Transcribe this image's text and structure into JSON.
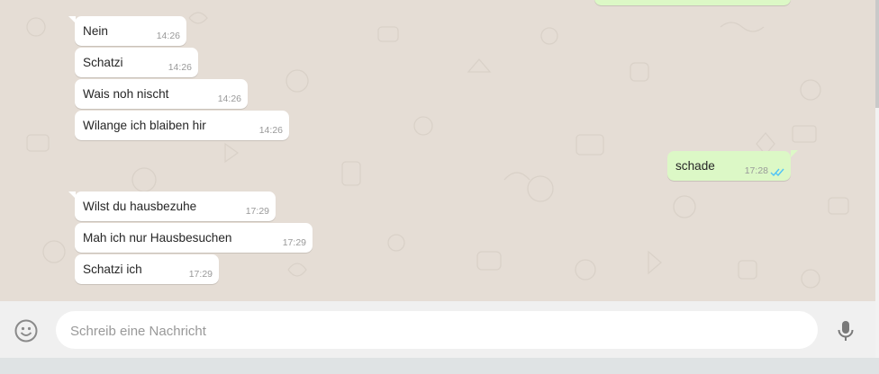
{
  "messages": [
    {
      "dir": "in",
      "text": "Nein",
      "time": "14:26"
    },
    {
      "dir": "in",
      "text": "Schatzi",
      "time": "14:26"
    },
    {
      "dir": "in",
      "text": "Wais noh nischt",
      "time": "14:26"
    },
    {
      "dir": "in",
      "text": "Wilange ich blaiben hir",
      "time": "14:26"
    },
    {
      "dir": "out",
      "text": "schade",
      "time": "17:28",
      "status": "read-double-check-icon"
    },
    {
      "dir": "in",
      "text": "Wilst du hausbezuhe",
      "time": "17:29"
    },
    {
      "dir": "in",
      "text": "Mah ich nur Hausbesuchen",
      "time": "17:29"
    },
    {
      "dir": "in",
      "text": "Schatzi ich",
      "time": "17:29"
    }
  ],
  "composer": {
    "placeholder": "Schreib eine Nachricht",
    "value": "",
    "emoji_icon": "emoji-icon",
    "mic_icon": "microphone-icon"
  },
  "colors": {
    "chat_background": "#e5ddd5",
    "incoming_bubble": "#ffffff",
    "outgoing_bubble": "#dcf8c6",
    "composer_background": "#f0f0f0",
    "read_ticks": "#4fc3f7"
  }
}
